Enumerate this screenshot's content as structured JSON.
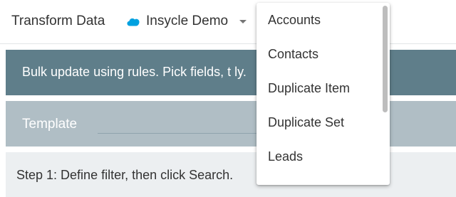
{
  "header": {
    "app_title": "Transform Data",
    "org": {
      "icon": "salesforce-cloud-icon",
      "name": "Insycle Demo",
      "caret_icon": "caret-down-icon"
    }
  },
  "banner": {
    "text": "Bulk update using rules. Pick fields, t                                        ly."
  },
  "template": {
    "label": "Template",
    "value": ""
  },
  "step": {
    "text": "Step 1: Define filter, then click Search."
  },
  "menu": {
    "items": [
      {
        "label": "Accounts"
      },
      {
        "label": "Contacts"
      },
      {
        "label": "Duplicate Item"
      },
      {
        "label": "Duplicate Set"
      },
      {
        "label": "Leads"
      }
    ]
  },
  "colors": {
    "banner": "#5f7e8a",
    "template_row": "#b0bec5",
    "step_row": "#eceff1",
    "salesforce_blue": "#00a1e0"
  }
}
